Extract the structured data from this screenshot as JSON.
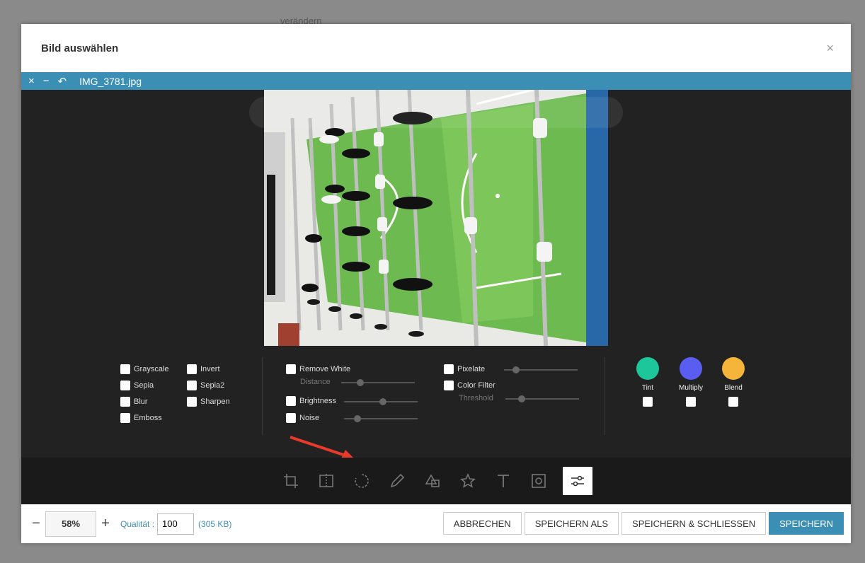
{
  "backdrop": {
    "text": "verändern"
  },
  "dialog": {
    "title": "Bild auswählen",
    "close_icon": "×"
  },
  "editor": {
    "close_icon": "×",
    "minimize_icon": "−",
    "undo_icon": "↶",
    "filename": "IMG_3781.jpg"
  },
  "filters": {
    "basic": [
      {
        "label": "Grayscale"
      },
      {
        "label": "Invert"
      },
      {
        "label": "Sepia"
      },
      {
        "label": "Sepia2"
      },
      {
        "label": "Blur"
      },
      {
        "label": "Sharpen"
      },
      {
        "label": "Emboss"
      }
    ],
    "remove_white": "Remove White",
    "distance": "Distance",
    "brightness": "Brightness",
    "noise": "Noise",
    "pixelate": "Pixelate",
    "color_filter": "Color Filter",
    "threshold": "Threshold",
    "blends": [
      {
        "label": "Tint",
        "color": "#1ec79b"
      },
      {
        "label": "Multiply",
        "color": "#5a5ef0"
      },
      {
        "label": "Blend",
        "color": "#f5b43a"
      }
    ]
  },
  "tools": [
    "crop-icon",
    "flip-icon",
    "rotate-icon",
    "draw-icon",
    "shape-icon",
    "icon-icon",
    "text-icon",
    "mask-icon",
    "filter-icon"
  ],
  "footer": {
    "zoom_minus": "−",
    "zoom_value": "58%",
    "zoom_plus": "+",
    "quality_label": "Qualität :",
    "quality_value": "100",
    "size": "(305 KB)",
    "cancel": "ABBRECHEN",
    "save_as": "SPEICHERN ALS",
    "save_close": "SPEICHERN & SCHLIESSEN",
    "save": "SPEICHERN"
  },
  "colors": {
    "accent": "#3b8fb4",
    "annotation_arrow": "#e8392a"
  }
}
